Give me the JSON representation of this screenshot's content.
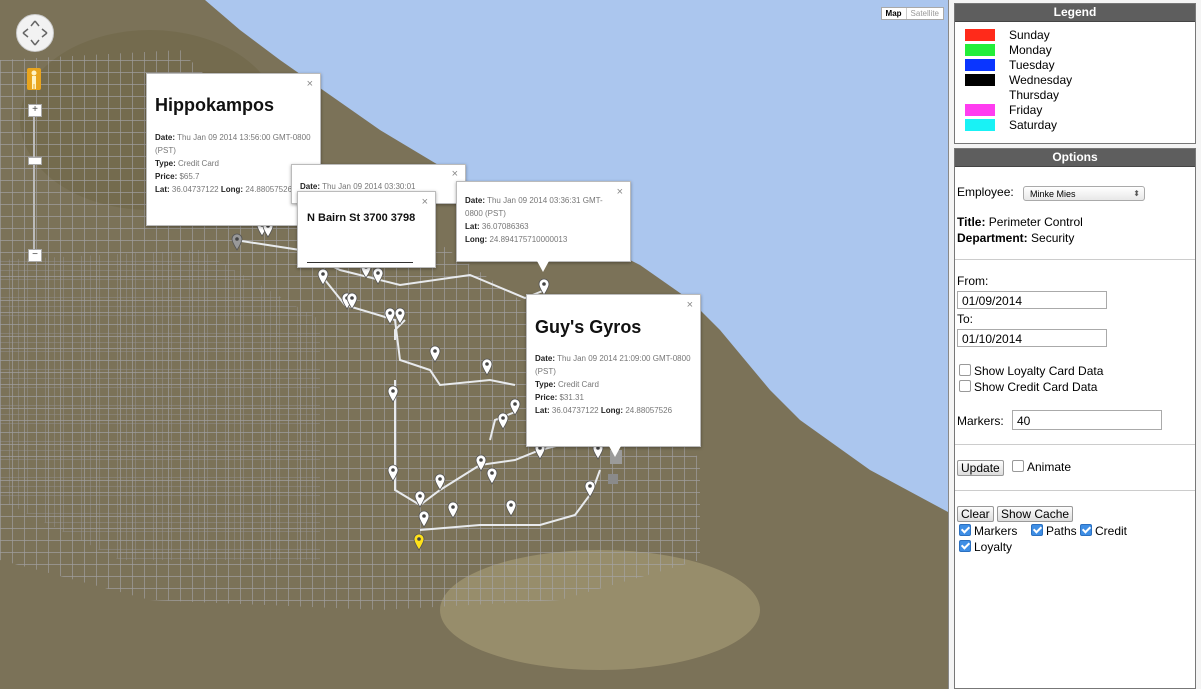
{
  "map": {
    "type_control": {
      "map": "Map",
      "satellite": "Satellite"
    },
    "zoom_in": "+",
    "zoom_out": "−",
    "info_windows": [
      {
        "title": "Hippokampos",
        "date_label": "Date:",
        "date_value": "Thu Jan 09 2014 13:56:00 GMT-0800 (PST)",
        "type_label": "Type:",
        "type_value": "Credit Card",
        "price_label": "Price:",
        "price_value": "$65.7",
        "lat_label": "Lat:",
        "lat_value": "36.04737122",
        "long_label": "Long:",
        "long_value": "24.88057526",
        "close": "×"
      },
      {
        "date_label": "Date:",
        "date_value": "Thu Jan 09 2014 03:30:01",
        "close": "×"
      },
      {
        "title": "N Bairn St 3700 3798",
        "close": "×"
      },
      {
        "date_label": "Date:",
        "date_value": "Thu Jan 09 2014 03:36:31 GMT-0800 (PST)",
        "lat_label": "Lat:",
        "lat_value": "36.07086363",
        "long_label": "Long:",
        "long_value": "24.894175710000013",
        "close": "×"
      },
      {
        "title": "Guy's Gyros",
        "date_label": "Date:",
        "date_value": "Thu Jan 09 2014 21:09:00 GMT-0800 (PST)",
        "type_label": "Type:",
        "type_value": "Credit Card",
        "price_label": "Price:",
        "price_value": "$31.31",
        "lat_label": "Lat:",
        "lat_value": "36.04737122",
        "long_label": "Long:",
        "long_value": "24.88057526",
        "close": "×"
      }
    ]
  },
  "legend": {
    "header": "Legend",
    "items": [
      {
        "label": "Sunday",
        "color": "#ff2a1a"
      },
      {
        "label": "Monday",
        "color": "#22ee3a"
      },
      {
        "label": "Tuesday",
        "color": "#0a35ff"
      },
      {
        "label": "Wednesday",
        "color": "#000000"
      },
      {
        "label": "Thursday",
        "color": "#ffffff"
      },
      {
        "label": "Friday",
        "color": "#ff3cf0"
      },
      {
        "label": "Saturday",
        "color": "#19f2f5"
      }
    ]
  },
  "options": {
    "header": "Options",
    "employee_label": "Employee:",
    "employee_value": "Minke Mies",
    "title_label": "Title:",
    "title_value": "Perimeter Control",
    "department_label": "Department:",
    "department_value": "Security",
    "from_label": "From:",
    "from_value": "01/09/2014",
    "to_label": "To:",
    "to_value": "01/10/2014",
    "show_loyalty": "Show Loyalty Card Data",
    "show_credit": "Show Credit Card Data",
    "markers_label": "Markers:",
    "markers_value": "40",
    "update_button": "Update",
    "animate_label": "Animate",
    "clear_button": "Clear",
    "show_cache_button": "Show Cache",
    "filter_markers": "Markers",
    "filter_paths": "Paths",
    "filter_credit": "Credit",
    "filter_loyalty": "Loyalty"
  }
}
